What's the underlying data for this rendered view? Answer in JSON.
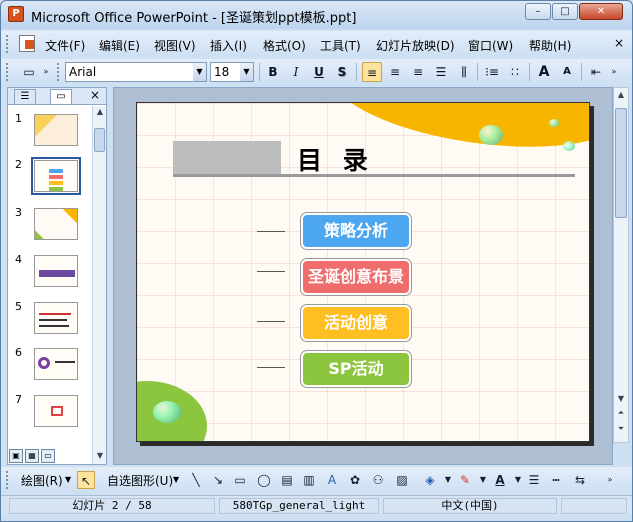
{
  "window": {
    "title": "Microsoft Office PowerPoint - [圣诞策划ppt模板.ppt]",
    "min": "–",
    "max": "□",
    "close": "✕"
  },
  "menu": {
    "items": [
      "文件(F)",
      "编辑(E)",
      "视图(V)",
      "插入(I)",
      "格式(O)",
      "工具(T)",
      "幻灯片放映(D)",
      "窗口(W)",
      "帮助(H)"
    ],
    "close": "×"
  },
  "toolbar": {
    "font": "Arial",
    "size": "18",
    "bold": "B",
    "italic": "I",
    "underline": "U",
    "shadow": "S",
    "grow": "A",
    "shrink": "A"
  },
  "pane": {
    "close": "×",
    "thumbs": [
      "1",
      "2",
      "3",
      "4",
      "5",
      "6",
      "7"
    ]
  },
  "slide": {
    "title": "目 录",
    "items": [
      "策略分析",
      "圣诞创意布景",
      "活动创意",
      "SP活动"
    ],
    "colors": [
      "#4ca6f0",
      "#ef6d6d",
      "#ffbe21",
      "#8cc63e"
    ]
  },
  "drawbar": {
    "draw": "绘图(R)",
    "autoshape": "自选图形(U)"
  },
  "status": {
    "slide": "幻灯片 2 / 58",
    "design": "580TGp_general_light",
    "lang": "中文(中国)"
  }
}
